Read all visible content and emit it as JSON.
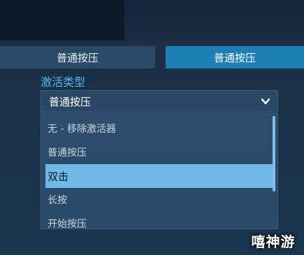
{
  "tabs": [
    {
      "label": "普通按压",
      "active": false
    },
    {
      "label": "普通按压",
      "active": true
    }
  ],
  "activation_type": {
    "label": "激活类型",
    "selected_value": "普通按压",
    "options": [
      {
        "label": "无 - 移除激活器",
        "selected": false
      },
      {
        "label": "普通按压",
        "selected": false
      },
      {
        "label": "双击",
        "selected": true
      },
      {
        "label": "长按",
        "selected": false
      },
      {
        "label": "开始按压",
        "selected": false
      }
    ]
  },
  "watermark": "嘻神游",
  "colors": {
    "accent": "#52b8f0",
    "active_tab": "#1d7fb3",
    "selected_option": "#6fb8e8"
  },
  "icons": {
    "select_indicator": "chevron-down-icon"
  }
}
